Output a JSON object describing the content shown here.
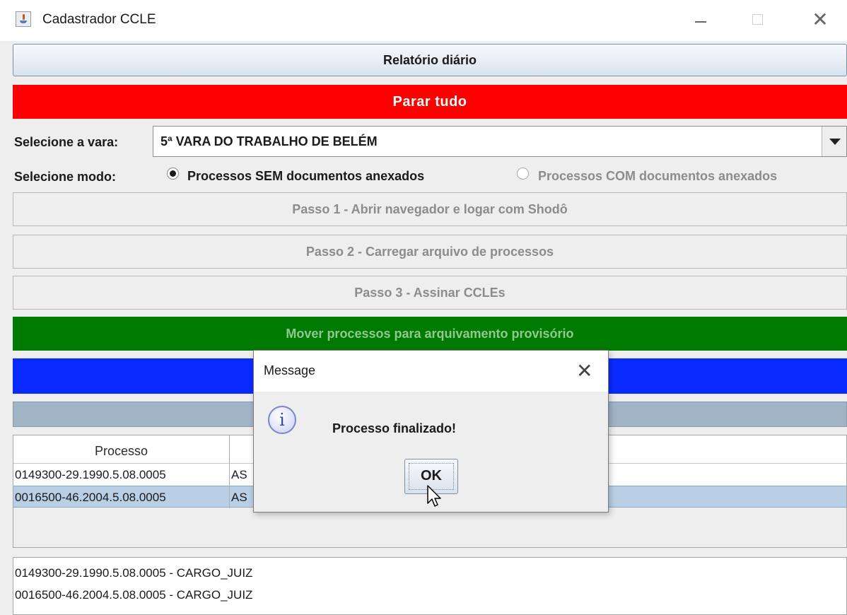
{
  "window": {
    "title": "Cadastrador CCLE"
  },
  "buttons": {
    "report": "Relatório diário",
    "stop_all": "Parar tudo",
    "step1": "Passo 1 - Abrir navegador e logar com Shodô",
    "step2": "Passo 2 - Carregar arquivo de processos",
    "step3": "Passo 3 - Assinar CCLEs",
    "move": "Mover processos para arquivamento provisório"
  },
  "vara": {
    "label": "Selecione a vara:",
    "selected": "5ª VARA DO TRABALHO DE BELÉM"
  },
  "mode": {
    "label": "Selecione modo:",
    "options": [
      {
        "label": "Processos SEM documentos anexados",
        "selected": true
      },
      {
        "label": "Processos COM documentos anexados",
        "selected": false
      }
    ]
  },
  "table": {
    "columns": [
      "Processo",
      ""
    ],
    "rows": [
      [
        "0149300-29.1990.5.08.0005",
        "AS"
      ],
      [
        "0016500-46.2004.5.08.0005",
        "AS"
      ]
    ]
  },
  "log": [
    "0149300-29.1990.5.08.0005 - CARGO_JUIZ",
    "0016500-46.2004.5.08.0005 - CARGO_JUIZ"
  ],
  "dialog": {
    "title": "Message",
    "message": "Processo finalizado!",
    "ok": "OK",
    "icon": "info-icon"
  },
  "colors": {
    "stop": "#ff0000",
    "move": "#007a00",
    "blue_bar": "#0a2bff",
    "gray_bar": "#a1b4c6",
    "selected_row": "#b8cfe5"
  }
}
